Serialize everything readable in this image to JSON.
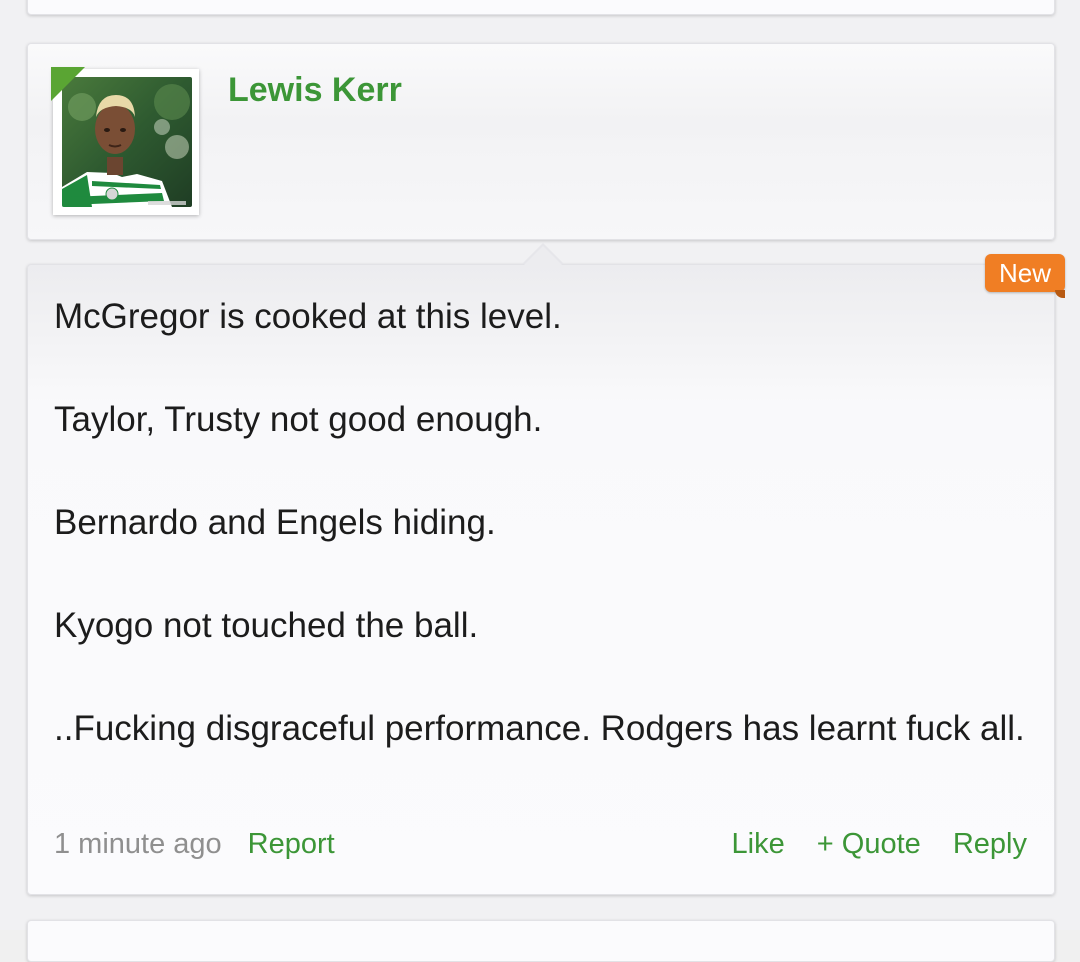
{
  "post": {
    "username": "Lewis Kerr",
    "new_badge": "New",
    "message_lines": [
      "McGregor is cooked at this level.",
      "Taylor, Trusty not good enough.",
      "Bernardo and Engels hiding.",
      "Kyogo not touched the ball.",
      "..Fucking disgraceful performance. Rodgers has learnt fuck all."
    ],
    "timestamp": "1 minute ago",
    "report_label": "Report",
    "like_label": "Like",
    "quote_label": "+ Quote",
    "reply_label": "Reply"
  },
  "colors": {
    "accent_green": "#3c9637",
    "online_indicator": "#5aa533",
    "new_badge": "#f07e24",
    "muted_text": "#8f8f8f",
    "body_text": "#1c1c1c"
  },
  "icons": {
    "avatar": "avatar-photo-footballer-green-white-hooped-kit",
    "online_indicator": "online-corner-triangle"
  }
}
